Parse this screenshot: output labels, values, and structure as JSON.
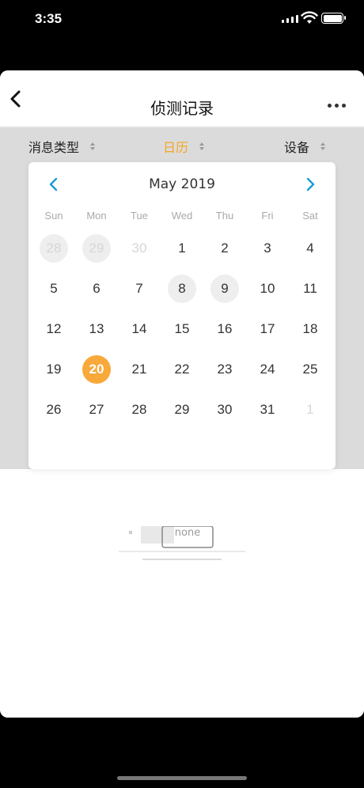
{
  "status_bar": {
    "time": "3:35"
  },
  "nav": {
    "title": "侦测记录"
  },
  "filters": [
    {
      "label": "消息类型",
      "active": false
    },
    {
      "label": "日历",
      "active": true
    },
    {
      "label": "设备",
      "active": false
    }
  ],
  "calendar": {
    "month_label": "May 2019",
    "weekdays": [
      "Sun",
      "Mon",
      "Tue",
      "Wed",
      "Thu",
      "Fri",
      "Sat"
    ],
    "days": [
      {
        "label": "28",
        "state": "other-marked"
      },
      {
        "label": "29",
        "state": "other-marked"
      },
      {
        "label": "30",
        "state": "other"
      },
      {
        "label": "1",
        "state": "normal"
      },
      {
        "label": "2",
        "state": "normal"
      },
      {
        "label": "3",
        "state": "normal"
      },
      {
        "label": "4",
        "state": "normal"
      },
      {
        "label": "5",
        "state": "normal"
      },
      {
        "label": "6",
        "state": "normal"
      },
      {
        "label": "7",
        "state": "normal"
      },
      {
        "label": "8",
        "state": "marked"
      },
      {
        "label": "9",
        "state": "marked"
      },
      {
        "label": "10",
        "state": "normal"
      },
      {
        "label": "11",
        "state": "normal"
      },
      {
        "label": "12",
        "state": "normal"
      },
      {
        "label": "13",
        "state": "normal"
      },
      {
        "label": "14",
        "state": "normal"
      },
      {
        "label": "15",
        "state": "normal"
      },
      {
        "label": "16",
        "state": "normal"
      },
      {
        "label": "17",
        "state": "normal"
      },
      {
        "label": "18",
        "state": "normal"
      },
      {
        "label": "19",
        "state": "normal"
      },
      {
        "label": "20",
        "state": "selected"
      },
      {
        "label": "21",
        "state": "normal"
      },
      {
        "label": "22",
        "state": "normal"
      },
      {
        "label": "23",
        "state": "normal"
      },
      {
        "label": "24",
        "state": "normal"
      },
      {
        "label": "25",
        "state": "normal"
      },
      {
        "label": "26",
        "state": "normal"
      },
      {
        "label": "27",
        "state": "normal"
      },
      {
        "label": "28",
        "state": "normal"
      },
      {
        "label": "29",
        "state": "normal"
      },
      {
        "label": "30",
        "state": "normal"
      },
      {
        "label": "31",
        "state": "normal"
      },
      {
        "label": "1",
        "state": "other"
      }
    ]
  },
  "empty_state": {
    "watermark": "none"
  },
  "colors": {
    "accent": "#f8a93a",
    "nav_arrow": "#1a9bd7",
    "active_filter": "#f5a623"
  }
}
